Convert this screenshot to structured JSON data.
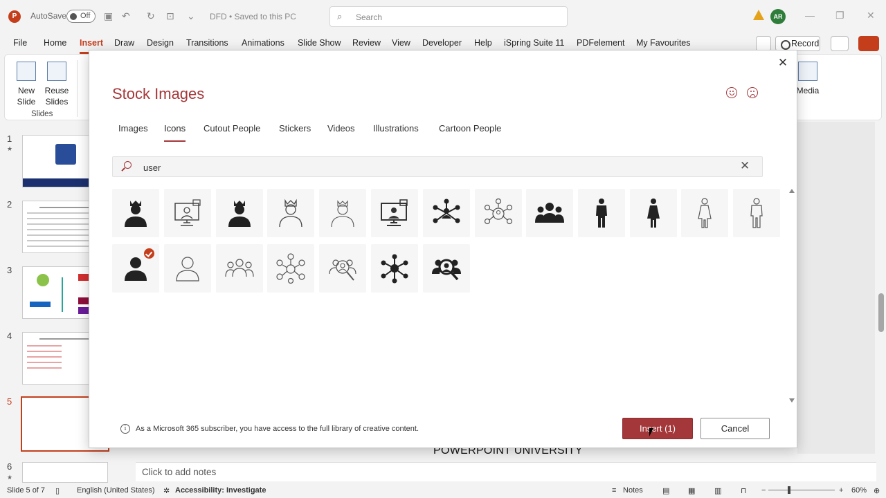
{
  "titlebar": {
    "autosave_label": "AutoSave",
    "autosave_state": "Off",
    "doc_title": "DFD • Saved to this PC",
    "search_placeholder": "Search",
    "avatar_initials": "AR"
  },
  "menu": {
    "tabs": [
      "File",
      "Home",
      "Insert",
      "Draw",
      "Design",
      "Transitions",
      "Animations",
      "Slide Show",
      "Review",
      "View",
      "Developer",
      "Help",
      "iSpring Suite 11",
      "PDFelement",
      "My Favourites"
    ],
    "active": "Insert",
    "record_label": "Record"
  },
  "ribbon": {
    "new_slide": "New Slide",
    "reuse_slides": "Reuse Slides",
    "group_slides": "Slides",
    "media": "Media"
  },
  "thumbnails": {
    "numbers": [
      "1",
      "2",
      "3",
      "4",
      "5",
      "6"
    ],
    "selected": "5"
  },
  "dialog": {
    "title": "Stock Images",
    "tabs": [
      "Images",
      "Icons",
      "Cutout People",
      "Stickers",
      "Videos",
      "Illustrations",
      "Cartoon People"
    ],
    "active_tab": "Icons",
    "search_value": "user",
    "icons": [
      "crowned-person-solid-icon",
      "monitor-user-outline-icon",
      "crowned-person-solid-icon",
      "crowned-person-outline-icon",
      "crowned-person-outline-icon",
      "monitor-user-icon",
      "network-user-solid-icon",
      "network-user-outline-icon",
      "group-users-solid-icon",
      "man-standing-solid-icon",
      "woman-standing-solid-icon",
      "woman-standing-outline-icon",
      "man-standing-outline-icon",
      "person-solid-icon",
      "person-outline-icon",
      "group-users-outline-icon",
      "network-users-outline-icon",
      "search-user-outline-icon",
      "network-user-solid-icon",
      "search-user-solid-icon"
    ],
    "selected_icon_index": 13,
    "info_text": "As a Microsoft 365 subscriber, you have access to the full library of creative content.",
    "insert_label": "Insert (1)",
    "cancel_label": "Cancel"
  },
  "notes_placeholder": "Click to add notes",
  "watermark": "POWERPOINT UNIVERSITY",
  "status": {
    "slide_info": "Slide 5 of 7",
    "language": "English (United States)",
    "accessibility": "Accessibility: Investigate",
    "notes": "Notes",
    "zoom": "60%"
  },
  "colors": {
    "accent": "#a4373a",
    "brand": "#c43e1c"
  }
}
